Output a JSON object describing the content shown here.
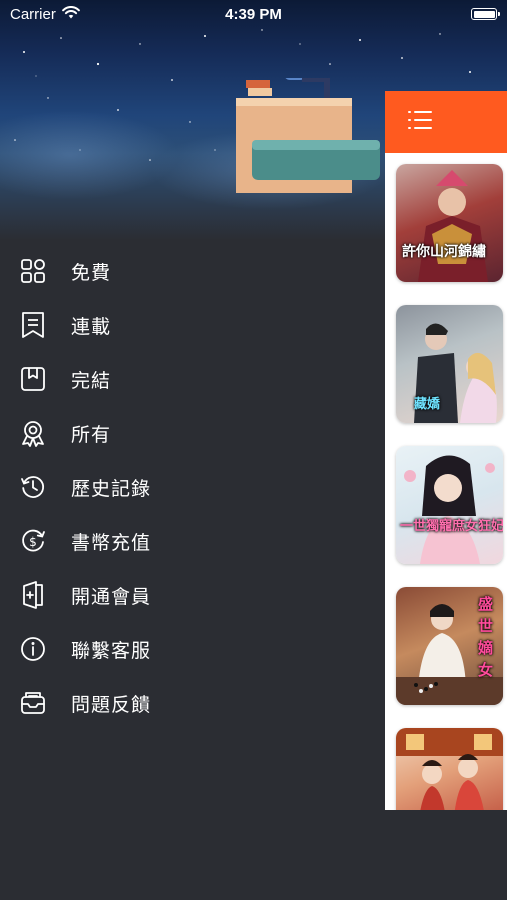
{
  "status_bar": {
    "carrier": "Carrier",
    "time": "4:39 PM",
    "wifi_icon": "wifi-icon",
    "battery_icon": "battery-icon"
  },
  "menu": {
    "items": [
      {
        "label": "免費",
        "icon": "grid-icon"
      },
      {
        "label": "連載",
        "icon": "bookmark-list-icon"
      },
      {
        "label": "完結",
        "icon": "bookmark-icon"
      },
      {
        "label": "所有",
        "icon": "award-icon"
      },
      {
        "label": "歷史記錄",
        "icon": "history-icon"
      },
      {
        "label": "書幣充值",
        "icon": "coin-icon"
      },
      {
        "label": "開通會員",
        "icon": "door-plus-icon"
      },
      {
        "label": "聯繫客服",
        "icon": "info-icon"
      },
      {
        "label": "問題反饋",
        "icon": "inbox-icon"
      }
    ]
  },
  "right_panel": {
    "header_icon": "list-menu-icon",
    "accent_color": "#ff5a1f",
    "covers": [
      {
        "title": "許你山河錦繡"
      },
      {
        "title": "藏嬌"
      },
      {
        "title": "一世獨寵庶女狂妃"
      },
      {
        "title": "盛世嫡女"
      },
      {
        "title": ""
      }
    ]
  },
  "colors": {
    "drawer_background": "#2b2d33",
    "text": "#ffffff"
  }
}
